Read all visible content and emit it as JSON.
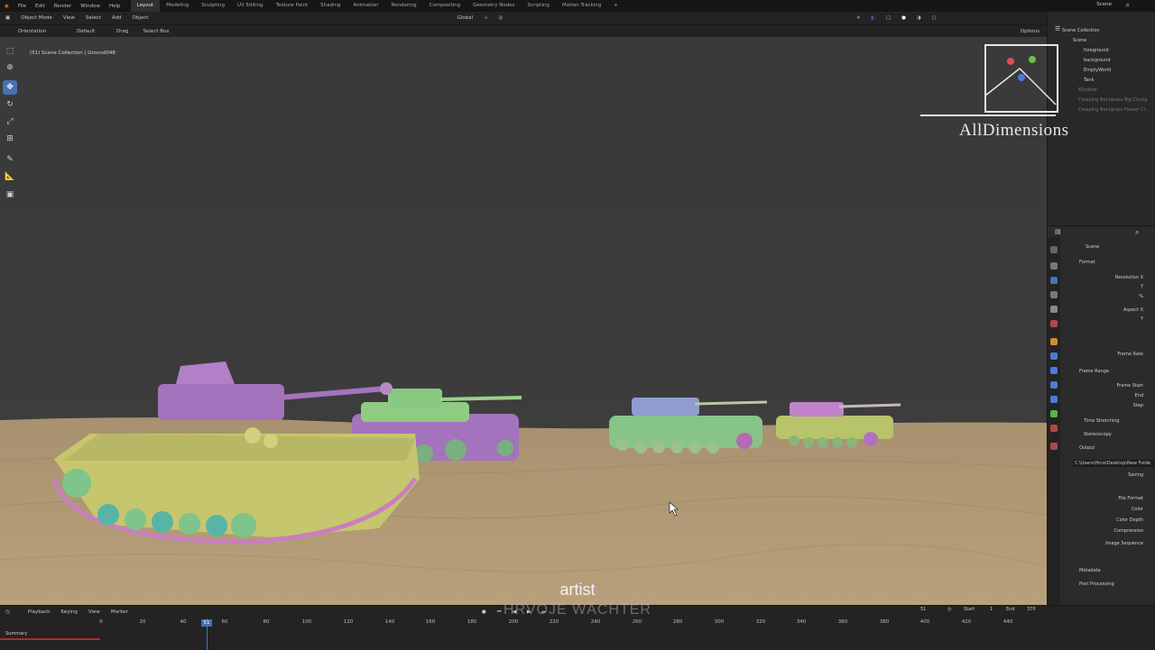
{
  "topbar": {
    "menus": [
      "File",
      "Edit",
      "Render",
      "Window",
      "Help"
    ],
    "workspaces": [
      "Layout",
      "Modeling",
      "Sculpting",
      "UV Editing",
      "Texture Paint",
      "Shading",
      "Animation",
      "Rendering",
      "Compositing",
      "Geometry Nodes",
      "Scripting",
      "Motion Tracking"
    ],
    "active_workspace": "Layout",
    "scene": "Scene"
  },
  "header": {
    "mode": "Object Mode",
    "menus": [
      "View",
      "Select",
      "Add",
      "Object"
    ],
    "transform": "Global",
    "options": "Options"
  },
  "tool_settings": {
    "orientation_label": "Orientation",
    "orientation_value": "Default",
    "drag_label": "Drag",
    "drag_value": "Select Box"
  },
  "viewport": {
    "info": "(51) Scene Collection | Ground048"
  },
  "outliner": {
    "rows": [
      "Scene Collection",
      "Scene",
      "foreground",
      "background",
      "EmptyWorld",
      "Tank",
      "EScatter",
      "Creeping Bentgrass Big Clump",
      "Creeping Bentgrass Flower Cl..."
    ]
  },
  "logo": {
    "text": "AllDimensions"
  },
  "properties": {
    "scene": "Scene",
    "panels": {
      "format": "Format",
      "resolution_x": "Resolution X",
      "y": "Y",
      "pct": "%",
      "aspect_x": "Aspect X",
      "frame_rate": "Frame Rate",
      "frame_range": "Frame Range",
      "frame_start": "Frame Start",
      "end": "End",
      "step": "Step",
      "time_stretching": "Time Stretching",
      "stereoscopy": "Stereoscopy",
      "output": "Output",
      "output_path": "C:\\Users\\Hrco\\Desktop\\New Folde",
      "saving": "Saving",
      "file_format": "File Format",
      "color": "Color",
      "color_depth": "Color Depth",
      "compression": "Compression",
      "image_sequence": "Image Sequence",
      "metadata": "Metadata",
      "post_processing": "Post Processing"
    }
  },
  "timeline": {
    "menus": [
      "Playback",
      "Keying",
      "View",
      "Marker"
    ],
    "current_frame": "51",
    "start_label": "Start",
    "start_value": "1",
    "end_label": "End",
    "end_value": "370",
    "summary": "Summary",
    "ticks": [
      "0",
      "20",
      "40",
      "60",
      "80",
      "100",
      "120",
      "140",
      "160",
      "180",
      "200",
      "220",
      "240",
      "260",
      "280",
      "300",
      "320",
      "340",
      "360",
      "380",
      "400",
      "420",
      "440"
    ]
  },
  "overlay": {
    "subtitle": "artist",
    "name": "HRVOJE WÄCHTER"
  },
  "colors": {
    "accent": "#4772b3",
    "sand": "#b59b76",
    "tank_yellow": "#c6c66e",
    "tank_purple": "#a373bd",
    "tank_green": "#86c487",
    "tank_blue": "#8f9cd0"
  }
}
